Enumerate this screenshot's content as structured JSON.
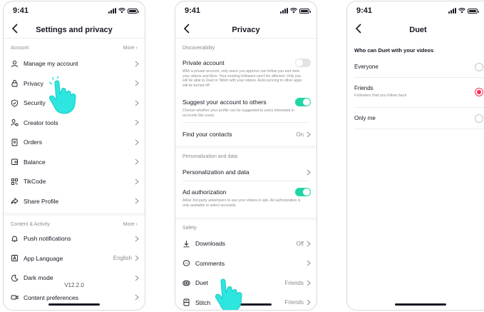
{
  "status_time": "9:41",
  "screen1": {
    "title": "Settings and privacy",
    "account_header": "Account",
    "account_more": "More",
    "account_items": [
      {
        "label": "Manage my account",
        "icon": "person-icon"
      },
      {
        "label": "Privacy",
        "icon": "lock-icon"
      },
      {
        "label": "Security",
        "icon": "shield-icon"
      },
      {
        "label": "Creator tools",
        "icon": "creator-tools-icon"
      },
      {
        "label": "Orders",
        "icon": "orders-icon"
      },
      {
        "label": "Balance",
        "icon": "wallet-icon"
      },
      {
        "label": "TikCode",
        "icon": "qr-code-icon"
      },
      {
        "label": "Share Profile",
        "icon": "share-icon"
      }
    ],
    "content_header": "Content & Activity",
    "content_more": "More",
    "content_items": [
      {
        "label": "Push notifications",
        "value": "",
        "icon": "bell-icon"
      },
      {
        "label": "App Language",
        "value": "English",
        "icon": "language-icon"
      },
      {
        "label": "Dark mode",
        "value": "",
        "icon": "moon-icon"
      },
      {
        "label": "Content preferences",
        "value": "",
        "icon": "video-icon"
      }
    ],
    "version": "V12.2.0"
  },
  "screen2": {
    "title": "Privacy",
    "discoverability_header": "Discoverability",
    "private_account_label": "Private account",
    "private_account_desc": "With a private account, only users you approve can follow you and view your videos and likes. Your existing followers won't be affected. Only you will be able to Duet or Stitch with your videos. Auto-syncing to other apps will be turned off.",
    "private_account_on": false,
    "suggest_label": "Suggest your account to others",
    "suggest_desc": "Choose whether your profile can be suggested to users interested in accounts like yours.",
    "suggest_on": true,
    "find_contacts_label": "Find your contacts",
    "find_contacts_value": "On",
    "personalization_header": "Personalization and data",
    "personalization_label": "Personalization and data",
    "ad_auth_label": "Ad authorization",
    "ad_auth_desc": "Allow 3rd-party advertisers to use your videos in ads. Ad authorization is only available to select accounts.",
    "ad_auth_on": true,
    "safety_header": "Safety",
    "safety_items": [
      {
        "label": "Downloads",
        "value": "Off",
        "icon": "download-icon"
      },
      {
        "label": "Comments",
        "value": "",
        "icon": "comment-icon"
      },
      {
        "label": "Duet",
        "value": "Friends",
        "icon": "duet-icon"
      },
      {
        "label": "Stitch",
        "value": "Friends",
        "icon": "stitch-icon"
      }
    ]
  },
  "screen3": {
    "title": "Duet",
    "question": "Who can Duet with your videos",
    "options": [
      {
        "label": "Everyone",
        "sub": "",
        "selected": false
      },
      {
        "label": "Friends",
        "sub": "Followers that you follow back",
        "selected": true
      },
      {
        "label": "Only me",
        "sub": "",
        "selected": false
      }
    ]
  },
  "colors": {
    "accent_toggle": "#20d5a4",
    "accent_radio": "#fe2c55",
    "hand": "#2ee6e0"
  }
}
